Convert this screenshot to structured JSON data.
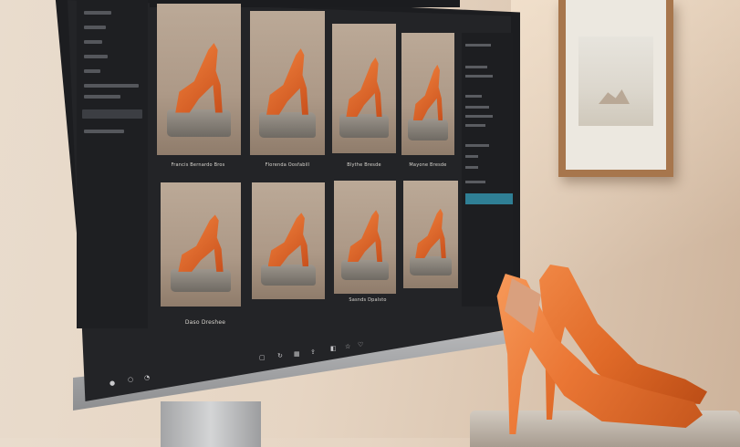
{
  "scene": {
    "description_colors": {
      "wall": "#e6d5c3",
      "screen_bg": "#232427",
      "accent_sidebar": "#2f7f95",
      "shoe_orange": "#e8732f",
      "frame_wood": "#a7764c"
    }
  },
  "screen": {
    "tiles_row1_labels": [
      "Francis Bernardo Bros",
      "Florenda Oosfabill",
      "Blythe Bresde",
      "Mayone Bresde"
    ],
    "tiles_row2_labels": [
      "Sasnds Dpalsto",
      "Daso Dreshee"
    ],
    "toolbar_icons": [
      "crop-icon",
      "rotate-icon",
      "grid-icon",
      "share-icon",
      "bookmark-icon",
      "star-icon",
      "heart-icon"
    ]
  }
}
